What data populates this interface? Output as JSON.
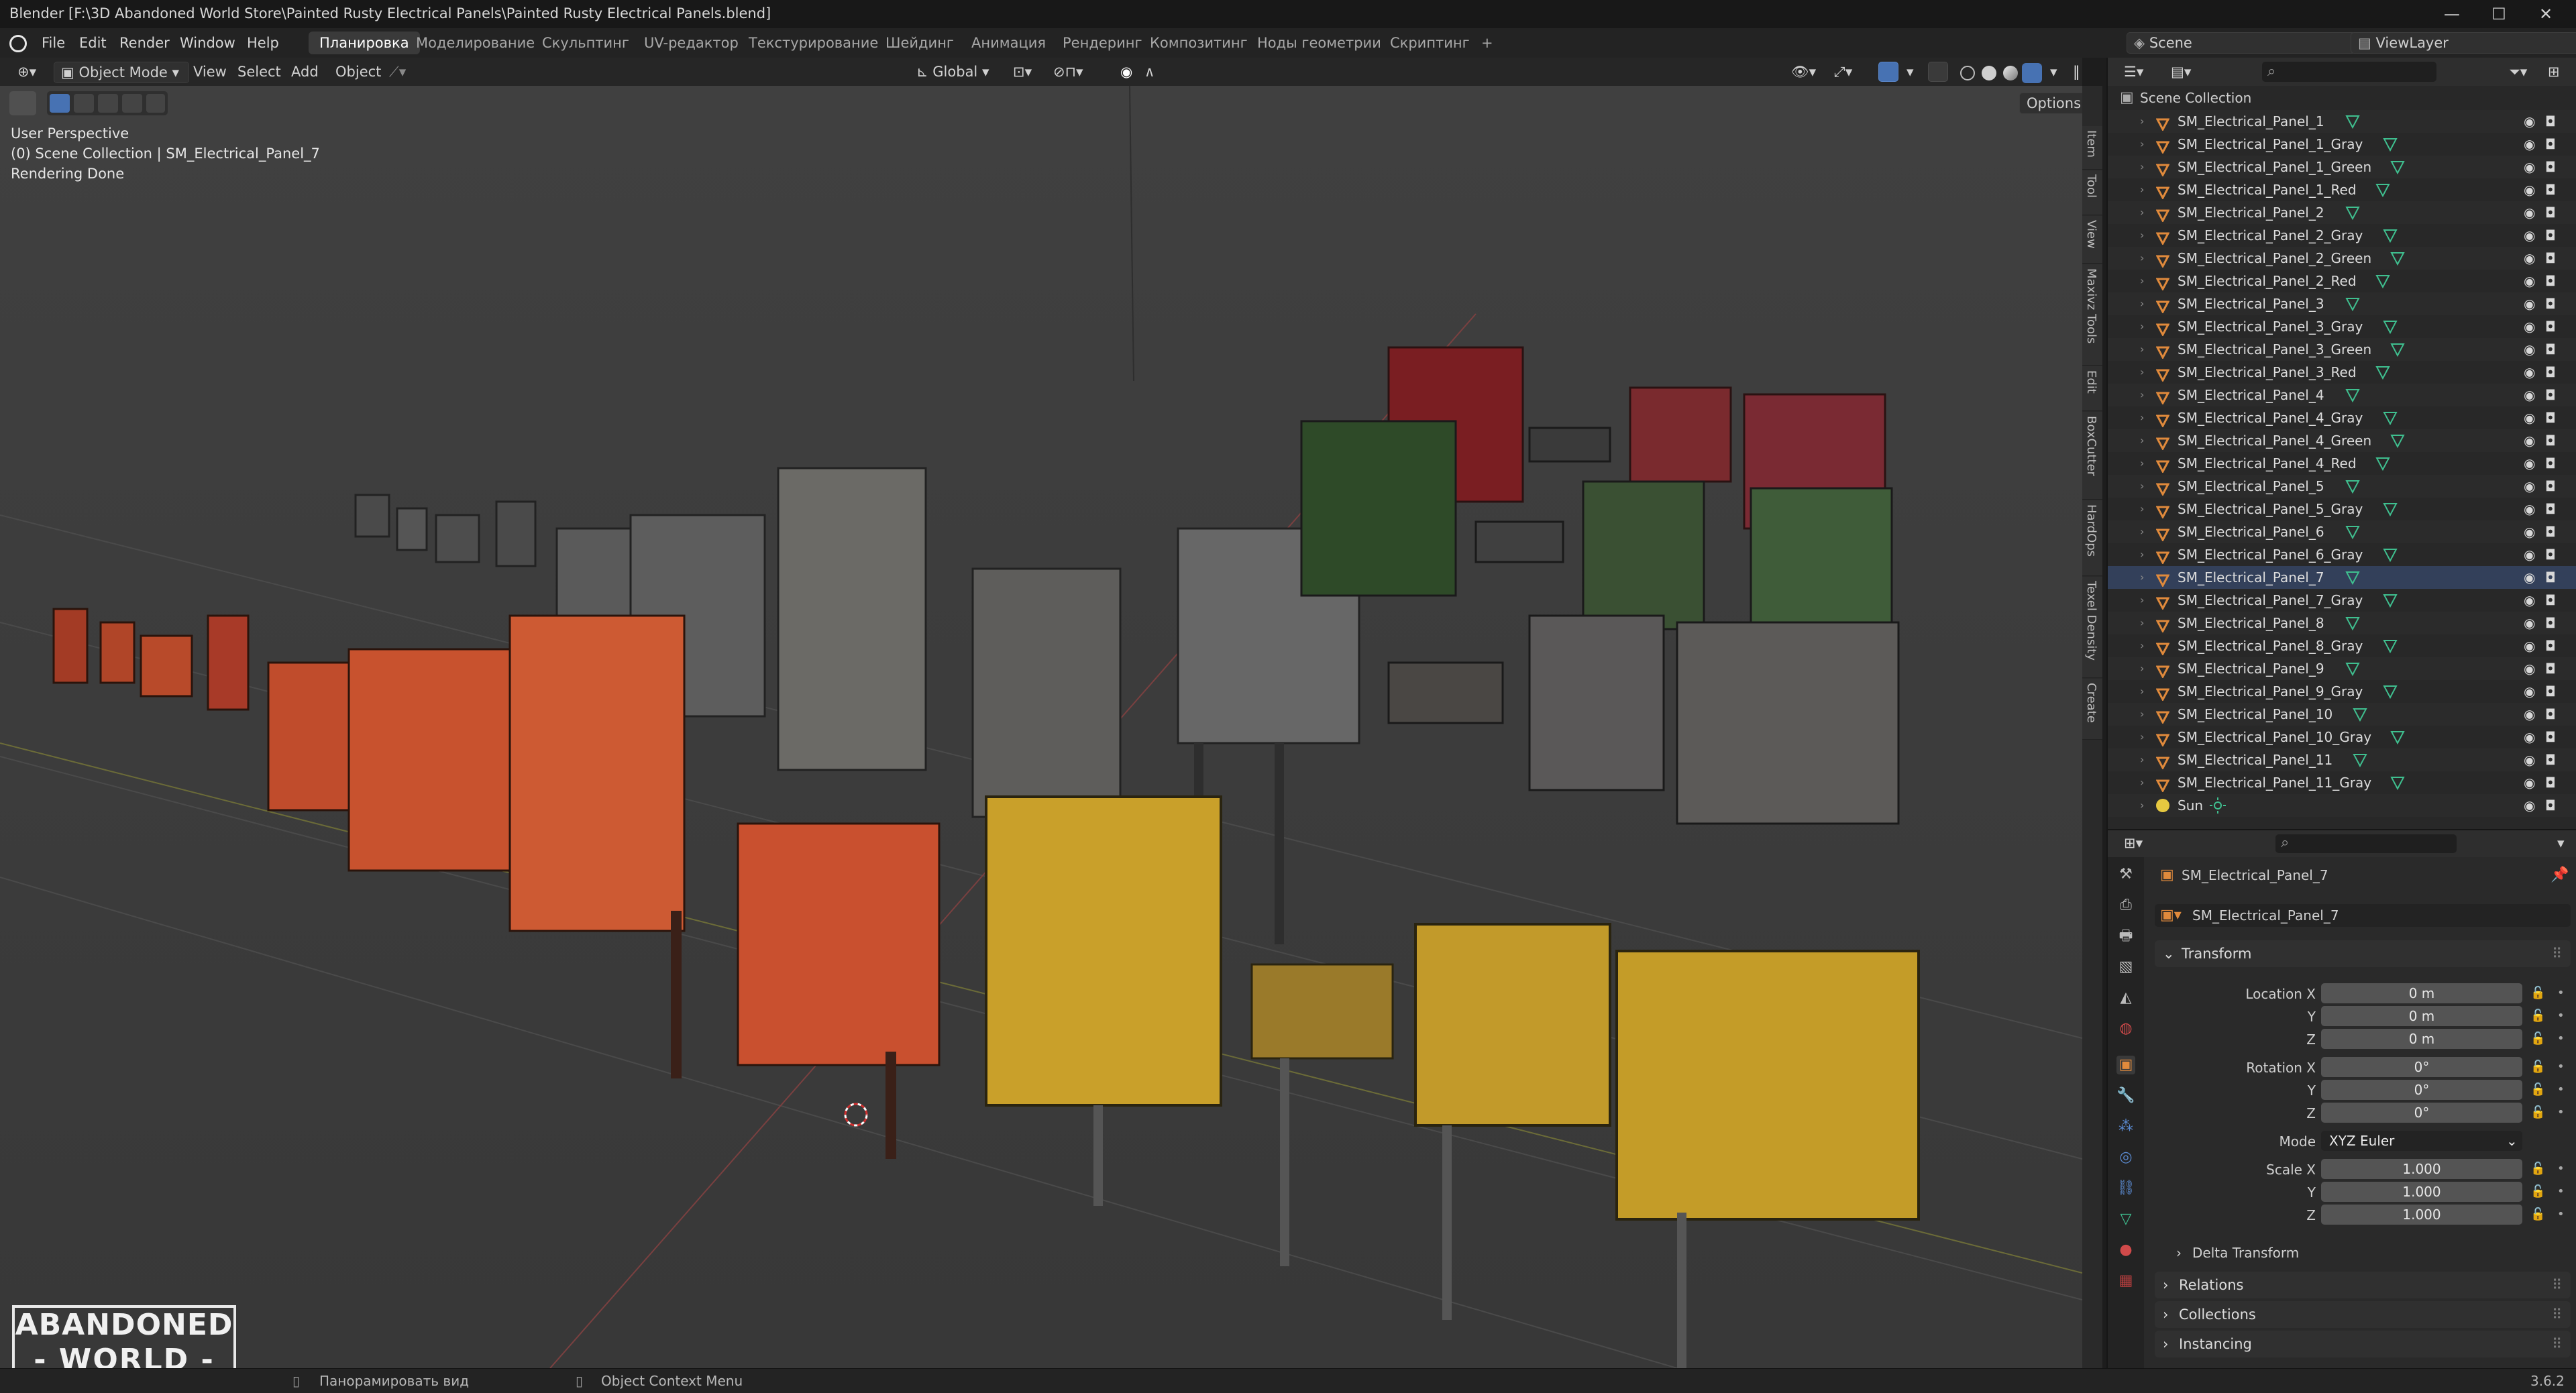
{
  "window": {
    "title": "Blender [F:\\3D Abandoned World Store\\Painted Rusty Electrical Panels\\Painted Rusty Electrical Panels.blend]",
    "min": "—",
    "max": "☐",
    "close": "✕"
  },
  "menu": {
    "items": [
      "File",
      "Edit",
      "Render",
      "Window",
      "Help"
    ],
    "workspaces": [
      "Планировка",
      "Моделирование",
      "Скульптинг",
      "UV-редактор",
      "Текстурирование",
      "Шейдинг",
      "Анимация",
      "Рендеринг",
      "Композитинг",
      "Ноды геометрии",
      "Скриптинг"
    ],
    "active_workspace": "Планировка",
    "add_tab": "+",
    "scene_label": "Scene",
    "viewlayer_label": "ViewLayer"
  },
  "viewport_header": {
    "mode": "Object Mode",
    "menus": [
      "View",
      "Select",
      "Add",
      "Object"
    ],
    "orientation": "Global",
    "options": "Options"
  },
  "viewport_overlay": {
    "line1": "User Perspective",
    "line2": "(0) Scene Collection | SM_Electrical_Panel_7",
    "line3": "Rendering Done"
  },
  "side_tabs": [
    "Item",
    "Tool",
    "View",
    "Maxivz Tools",
    "Edit",
    "BoxCutter",
    "HardOps",
    "Texel Density",
    "Create"
  ],
  "watermark": {
    "line1": "ABANDONED",
    "line2": "- WORLD -"
  },
  "outliner": {
    "root": "Scene Collection",
    "selected": "SM_Electrical_Panel_7",
    "items": [
      "SM_Electrical_Panel_1",
      "SM_Electrical_Panel_1_Gray",
      "SM_Electrical_Panel_1_Green",
      "SM_Electrical_Panel_1_Red",
      "SM_Electrical_Panel_2",
      "SM_Electrical_Panel_2_Gray",
      "SM_Electrical_Panel_2_Green",
      "SM_Electrical_Panel_2_Red",
      "SM_Electrical_Panel_3",
      "SM_Electrical_Panel_3_Gray",
      "SM_Electrical_Panel_3_Green",
      "SM_Electrical_Panel_3_Red",
      "SM_Electrical_Panel_4",
      "SM_Electrical_Panel_4_Gray",
      "SM_Electrical_Panel_4_Green",
      "SM_Electrical_Panel_4_Red",
      "SM_Electrical_Panel_5",
      "SM_Electrical_Panel_5_Gray",
      "SM_Electrical_Panel_6",
      "SM_Electrical_Panel_6_Gray",
      "SM_Electrical_Panel_7",
      "SM_Electrical_Panel_7_Gray",
      "SM_Electrical_Panel_8",
      "SM_Electrical_Panel_8_Gray",
      "SM_Electrical_Panel_9",
      "SM_Electrical_Panel_9_Gray",
      "SM_Electrical_Panel_10",
      "SM_Electrical_Panel_10_Gray",
      "SM_Electrical_Panel_11",
      "SM_Electrical_Panel_11_Gray",
      "Sun"
    ]
  },
  "properties": {
    "object_name": "SM_Electrical_Panel_7",
    "object_name_field": "SM_Electrical_Panel_7",
    "transform_label": "Transform",
    "location_x_label": "Location X",
    "y_label": "Y",
    "z_label": "Z",
    "location": [
      "0 m",
      "0 m",
      "0 m"
    ],
    "rotation_x_label": "Rotation X",
    "rotation": [
      "0°",
      "0°",
      "0°"
    ],
    "mode_label": "Mode",
    "mode_value": "XYZ Euler",
    "scale_x_label": "Scale X",
    "scale": [
      "1.000",
      "1.000",
      "1.000"
    ],
    "sections": [
      "Delta Transform",
      "Relations",
      "Collections",
      "Instancing"
    ]
  },
  "statusbar": {
    "pan": "Панорамировать вид",
    "context": "Object Context Menu",
    "version": "3.6.2"
  },
  "colors": {
    "accent": "#4772b3",
    "mesh_icon": "#3fbf8f",
    "object_icon": "#e08a3c",
    "sun_icon": "#e6c840"
  }
}
